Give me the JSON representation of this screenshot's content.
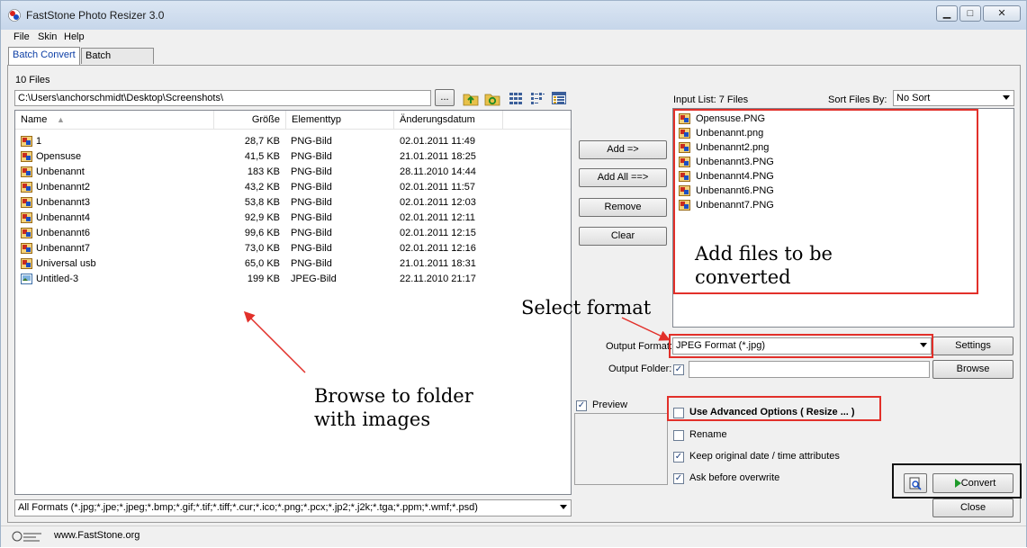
{
  "window": {
    "title": "FastStone Photo Resizer 3.0",
    "buttons": {
      "minimize": "▁",
      "maximize": "□",
      "close": "✕"
    }
  },
  "menu": [
    "File",
    "Skin",
    "Help"
  ],
  "tabs": [
    "Batch Convert",
    "Batch Rename"
  ],
  "browser": {
    "file_count": "10 Files",
    "path": "C:\\Users\\anchorschmidt\\Desktop\\Screenshots\\",
    "browse_label": "...",
    "columns": [
      "Name",
      "Größe",
      "Elementtyp",
      "Änderungsdatum"
    ],
    "files": [
      {
        "name": "1",
        "size": "28,7 KB",
        "type": "PNG-Bild",
        "date": "02.01.2011 11:49"
      },
      {
        "name": "Opensuse",
        "size": "41,5 KB",
        "type": "PNG-Bild",
        "date": "21.01.2011 18:25"
      },
      {
        "name": "Unbenannt",
        "size": "183 KB",
        "type": "PNG-Bild",
        "date": "28.11.2010 14:44"
      },
      {
        "name": "Unbenannt2",
        "size": "43,2 KB",
        "type": "PNG-Bild",
        "date": "02.01.2011 11:57"
      },
      {
        "name": "Unbenannt3",
        "size": "53,8 KB",
        "type": "PNG-Bild",
        "date": "02.01.2011 12:03"
      },
      {
        "name": "Unbenannt4",
        "size": "92,9 KB",
        "type": "PNG-Bild",
        "date": "02.01.2011 12:11"
      },
      {
        "name": "Unbenannt6",
        "size": "99,6 KB",
        "type": "PNG-Bild",
        "date": "02.01.2011 12:15"
      },
      {
        "name": "Unbenannt7",
        "size": "73,0 KB",
        "type": "PNG-Bild",
        "date": "02.01.2011 12:16"
      },
      {
        "name": "Universal usb",
        "size": "65,0 KB",
        "type": "PNG-Bild",
        "date": "21.01.2011 18:31"
      },
      {
        "name": "Untitled-3",
        "size": "199 KB",
        "type": "JPEG-Bild",
        "date": "22.11.2010 21:17"
      }
    ],
    "filter": "All Formats (*.jpg;*.jpe;*.jpeg;*.bmp;*.gif;*.tif;*.tiff;*.cur;*.ico;*.png;*.pcx;*.jp2;*.j2k;*.tga;*.ppm;*.wmf;*.psd)"
  },
  "actions": {
    "add": "Add =>",
    "add_all": "Add All ==>",
    "remove": "Remove",
    "clear": "Clear"
  },
  "input_list": {
    "label": "Input List:  7 Files",
    "sort_label": "Sort Files By:",
    "sort_value": "No Sort",
    "files": [
      "Opensuse.PNG",
      "Unbenannt.png",
      "Unbenannt2.png",
      "Unbenannt3.PNG",
      "Unbenannt4.PNG",
      "Unbenannt6.PNG",
      "Unbenannt7.PNG"
    ]
  },
  "output": {
    "format_label": "Output Format:",
    "format_value": "JPEG Format (*.jpg)",
    "settings_label": "Settings",
    "folder_label": "Output Folder:",
    "folder_value": "",
    "browse_label": "Browse"
  },
  "preview_label": "Preview",
  "options": {
    "advanced": "Use Advanced Options ( Resize ... )",
    "rename": "Rename",
    "keep_date": "Keep original date / time attributes",
    "ask_overwrite": "Ask before overwrite"
  },
  "convert_label": "Convert",
  "close_label": "Close",
  "status": {
    "website": "www.FastStone.org"
  },
  "annotations": {
    "add_files": [
      "Add files to be",
      "converted"
    ],
    "select_format": "Select format",
    "browse": [
      "Browse to folder",
      "with images"
    ]
  },
  "colors": {
    "annotation": "#e2302a",
    "tab_active_text": "#0c3ea5"
  }
}
